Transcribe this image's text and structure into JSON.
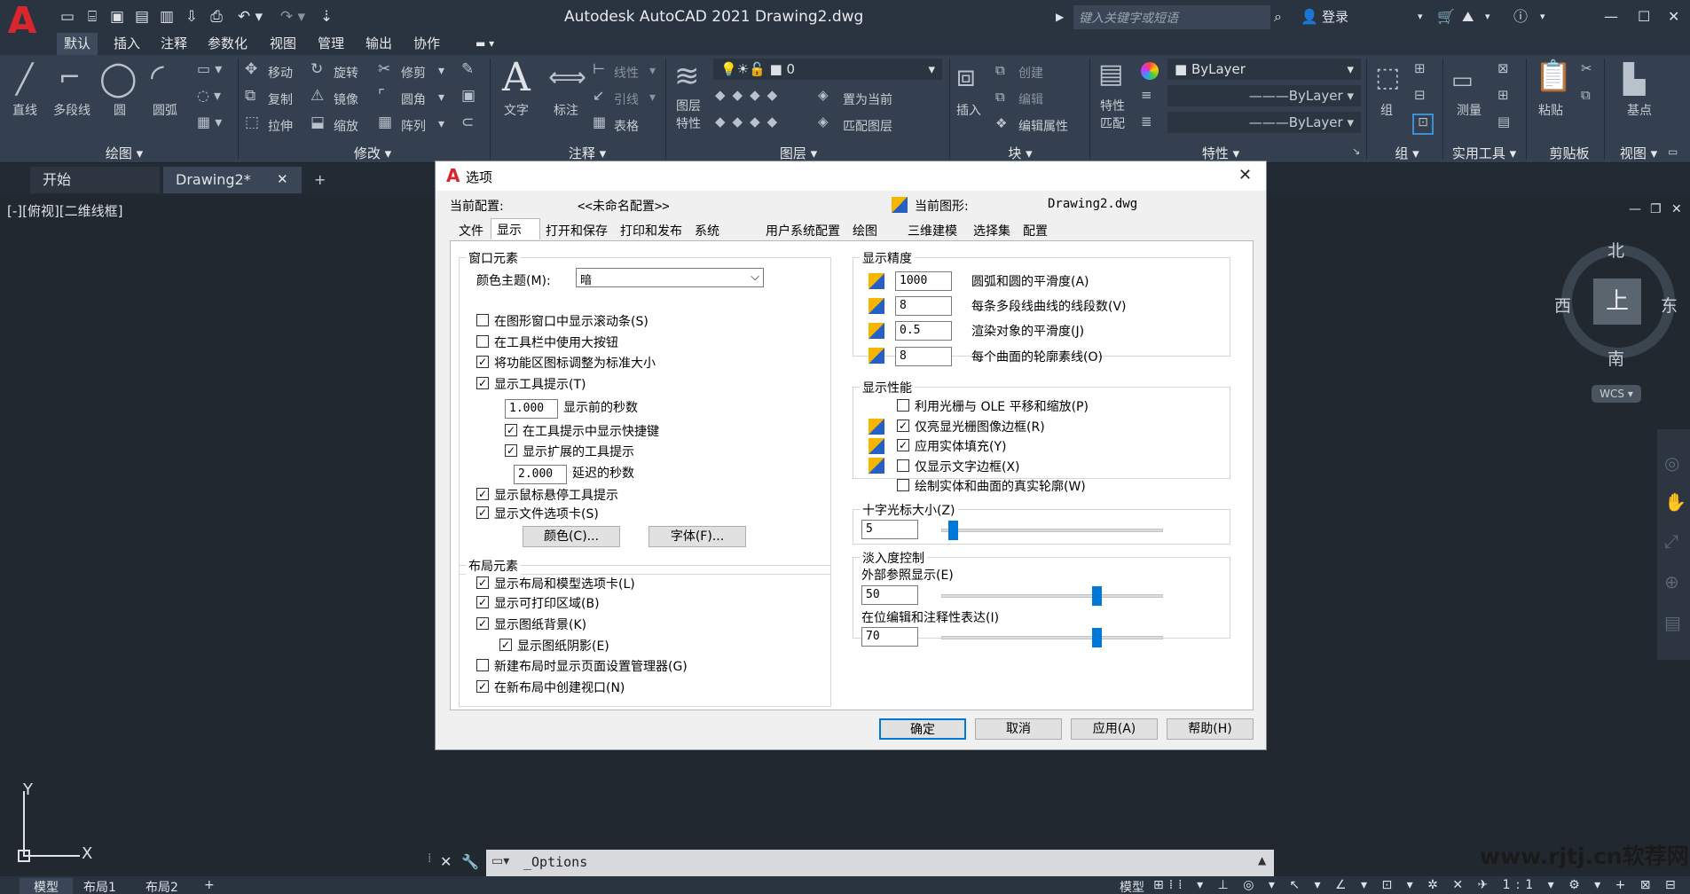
{
  "app": {
    "logo": "A",
    "title": "Autodesk AutoCAD 2021    Drawing2.dwg",
    "search_placeholder": "键入关键字或短语",
    "login": "登录"
  },
  "ribbon": {
    "tabs": [
      "默认",
      "插入",
      "注释",
      "参数化",
      "视图",
      "管理",
      "输出",
      "协作"
    ],
    "active_tab": "默认",
    "draw": {
      "title": "绘图",
      "line": "直线",
      "polyline": "多段线",
      "circle": "圆",
      "arc": "圆弧"
    },
    "modify": {
      "title": "修改",
      "move": "移动",
      "rotate": "旋转",
      "trim": "修剪",
      "copy": "复制",
      "mirror": "镜像",
      "fillet": "圆角",
      "stretch": "拉伸",
      "scale": "缩放",
      "array": "阵列"
    },
    "annotation": {
      "title": "注释",
      "text": "文字",
      "dimension": "标注",
      "linear": "线性",
      "leader": "引线",
      "table": "表格"
    },
    "layers": {
      "title": "图层",
      "layer_properties": "图层\n特性",
      "layer_value": "0",
      "set_current": "置为当前",
      "match_layer": "匹配图层"
    },
    "block": {
      "title": "块",
      "insert": "插入",
      "create": "创建",
      "edit": "编辑",
      "edit_attributes": "编辑属性"
    },
    "properties": {
      "title": "特性",
      "match_properties": "特性\n匹配",
      "color": "ByLayer",
      "linetype": "ByLayer",
      "lineweight": "ByLayer"
    },
    "groups": {
      "title": "组",
      "group": "组"
    },
    "utilities": {
      "title": "实用工具",
      "measure": "测量"
    },
    "clipboard": {
      "title": "剪贴板",
      "paste": "粘贴"
    },
    "view": {
      "title": "视图",
      "base": "基点"
    }
  },
  "doc_tabs": {
    "start": "开始",
    "drawing": "Drawing2*",
    "add": "+"
  },
  "viewport": {
    "label": "[-][俯视][二维线框]",
    "compass": {
      "north": "北",
      "south": "南",
      "east": "东",
      "west": "西",
      "top": "上"
    },
    "wcs": "WCS",
    "ucs_y": "Y",
    "ucs_x": "X"
  },
  "dialog": {
    "title": "选项",
    "current_profile_label": "当前配置:",
    "current_profile_value": "<<未命名配置>>",
    "current_drawing_label": "当前图形:",
    "current_drawing_value": "Drawing2.dwg",
    "tabs": [
      "文件",
      "显示",
      "打开和保存",
      "打印和发布",
      "系统",
      "用户系统配置",
      "绘图",
      "三维建模",
      "选择集",
      "配置"
    ],
    "active_tab": "显示",
    "window_elements": {
      "title": "窗口元素",
      "color_theme_label": "颜色主题(M):",
      "color_theme_value": "暗",
      "scrollbars": "在图形窗口中显示滚动条(S)",
      "large_buttons": "在工具栏中使用大按钮",
      "resize_ribbon_icons": "将功能区图标调整为标准大小",
      "show_tooltips": "显示工具提示(T)",
      "seconds_before": "显示前的秒数",
      "seconds_before_value": "1.000",
      "shortcut_in_tooltips": "在工具提示中显示快捷键",
      "extended_tooltips": "显示扩展的工具提示",
      "delay_seconds": "延迟的秒数",
      "delay_seconds_value": "2.000",
      "rollover_tooltips": "显示鼠标悬停工具提示",
      "file_tabs": "显示文件选项卡(S)",
      "colors_button": "颜色(C)...",
      "fonts_button": "字体(F)..."
    },
    "layout_elements": {
      "title": "布局元素",
      "layout_model_tabs": "显示布局和模型选项卡(L)",
      "printable_area": "显示可打印区域(B)",
      "paper_background": "显示图纸背景(K)",
      "paper_shadow": "显示图纸阴影(E)",
      "page_setup_manager": "新建布局时显示页面设置管理器(G)",
      "create_viewport": "在新布局中创建视口(N)"
    },
    "display_resolution": {
      "title": "显示精度",
      "arc_smoothness": "圆弧和圆的平滑度(A)",
      "arc_smoothness_value": "1000",
      "polyline_segments": "每条多段线曲线的线段数(V)",
      "polyline_segments_value": "8",
      "rendered_smoothness": "渲染对象的平滑度(J)",
      "rendered_smoothness_value": "0.5",
      "contour_lines": "每个曲面的轮廓素线(O)",
      "contour_lines_value": "8"
    },
    "display_performance": {
      "title": "显示性能",
      "raster_ole": "利用光栅与 OLE 平移和缩放(P)",
      "highlight_raster": "仅亮显光栅图像边框(R)",
      "solid_fill": "应用实体填充(Y)",
      "text_boundary": "仅显示文字边框(X)",
      "true_silhouettes": "绘制实体和曲面的真实轮廓(W)"
    },
    "crosshair": {
      "title": "十字光标大小(Z)",
      "value": "5",
      "level": 0.05
    },
    "fade_control": {
      "title": "淡入度控制",
      "xref_label": "外部参照显示(E)",
      "xref_value": "50",
      "xref_level": 0.7,
      "inplace_label": "在位编辑和注释性表达(I)",
      "inplace_value": "70",
      "inplace_level": 0.7
    },
    "buttons": {
      "ok": "确定",
      "cancel": "取消",
      "apply": "应用(A)",
      "help": "帮助(H)"
    }
  },
  "command_line": {
    "text": "_Options"
  },
  "status": {
    "model": "模型",
    "layout1": "布局1",
    "layout2": "布局2",
    "add": "+",
    "model_right": "模型"
  },
  "watermark": "www.rjtj.cn软荐网"
}
